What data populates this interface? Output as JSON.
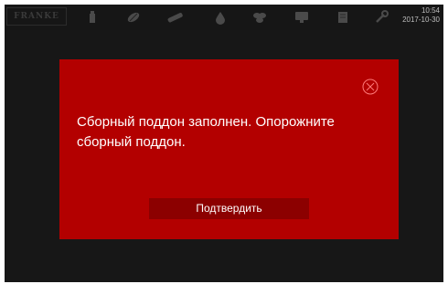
{
  "header": {
    "logo_text": "FRANKE",
    "time": "10:54",
    "date": "2017-10-30",
    "icons": [
      "beverage-icon",
      "cleaning-icon",
      "milk-icon",
      "drop-icon",
      "beans-icon",
      "display-icon",
      "book-icon",
      "wrench-icon"
    ]
  },
  "dialog": {
    "message": "Сборный поддон заполнен. Опорожните сборный поддон.",
    "confirm_label": "Подтвердить",
    "close_icon": "close-icon"
  },
  "colors": {
    "dialog_bg": "#b30000",
    "button_bg": "#8c0000",
    "screen_bg": "#171717",
    "icon_color": "#4a4a4a"
  }
}
